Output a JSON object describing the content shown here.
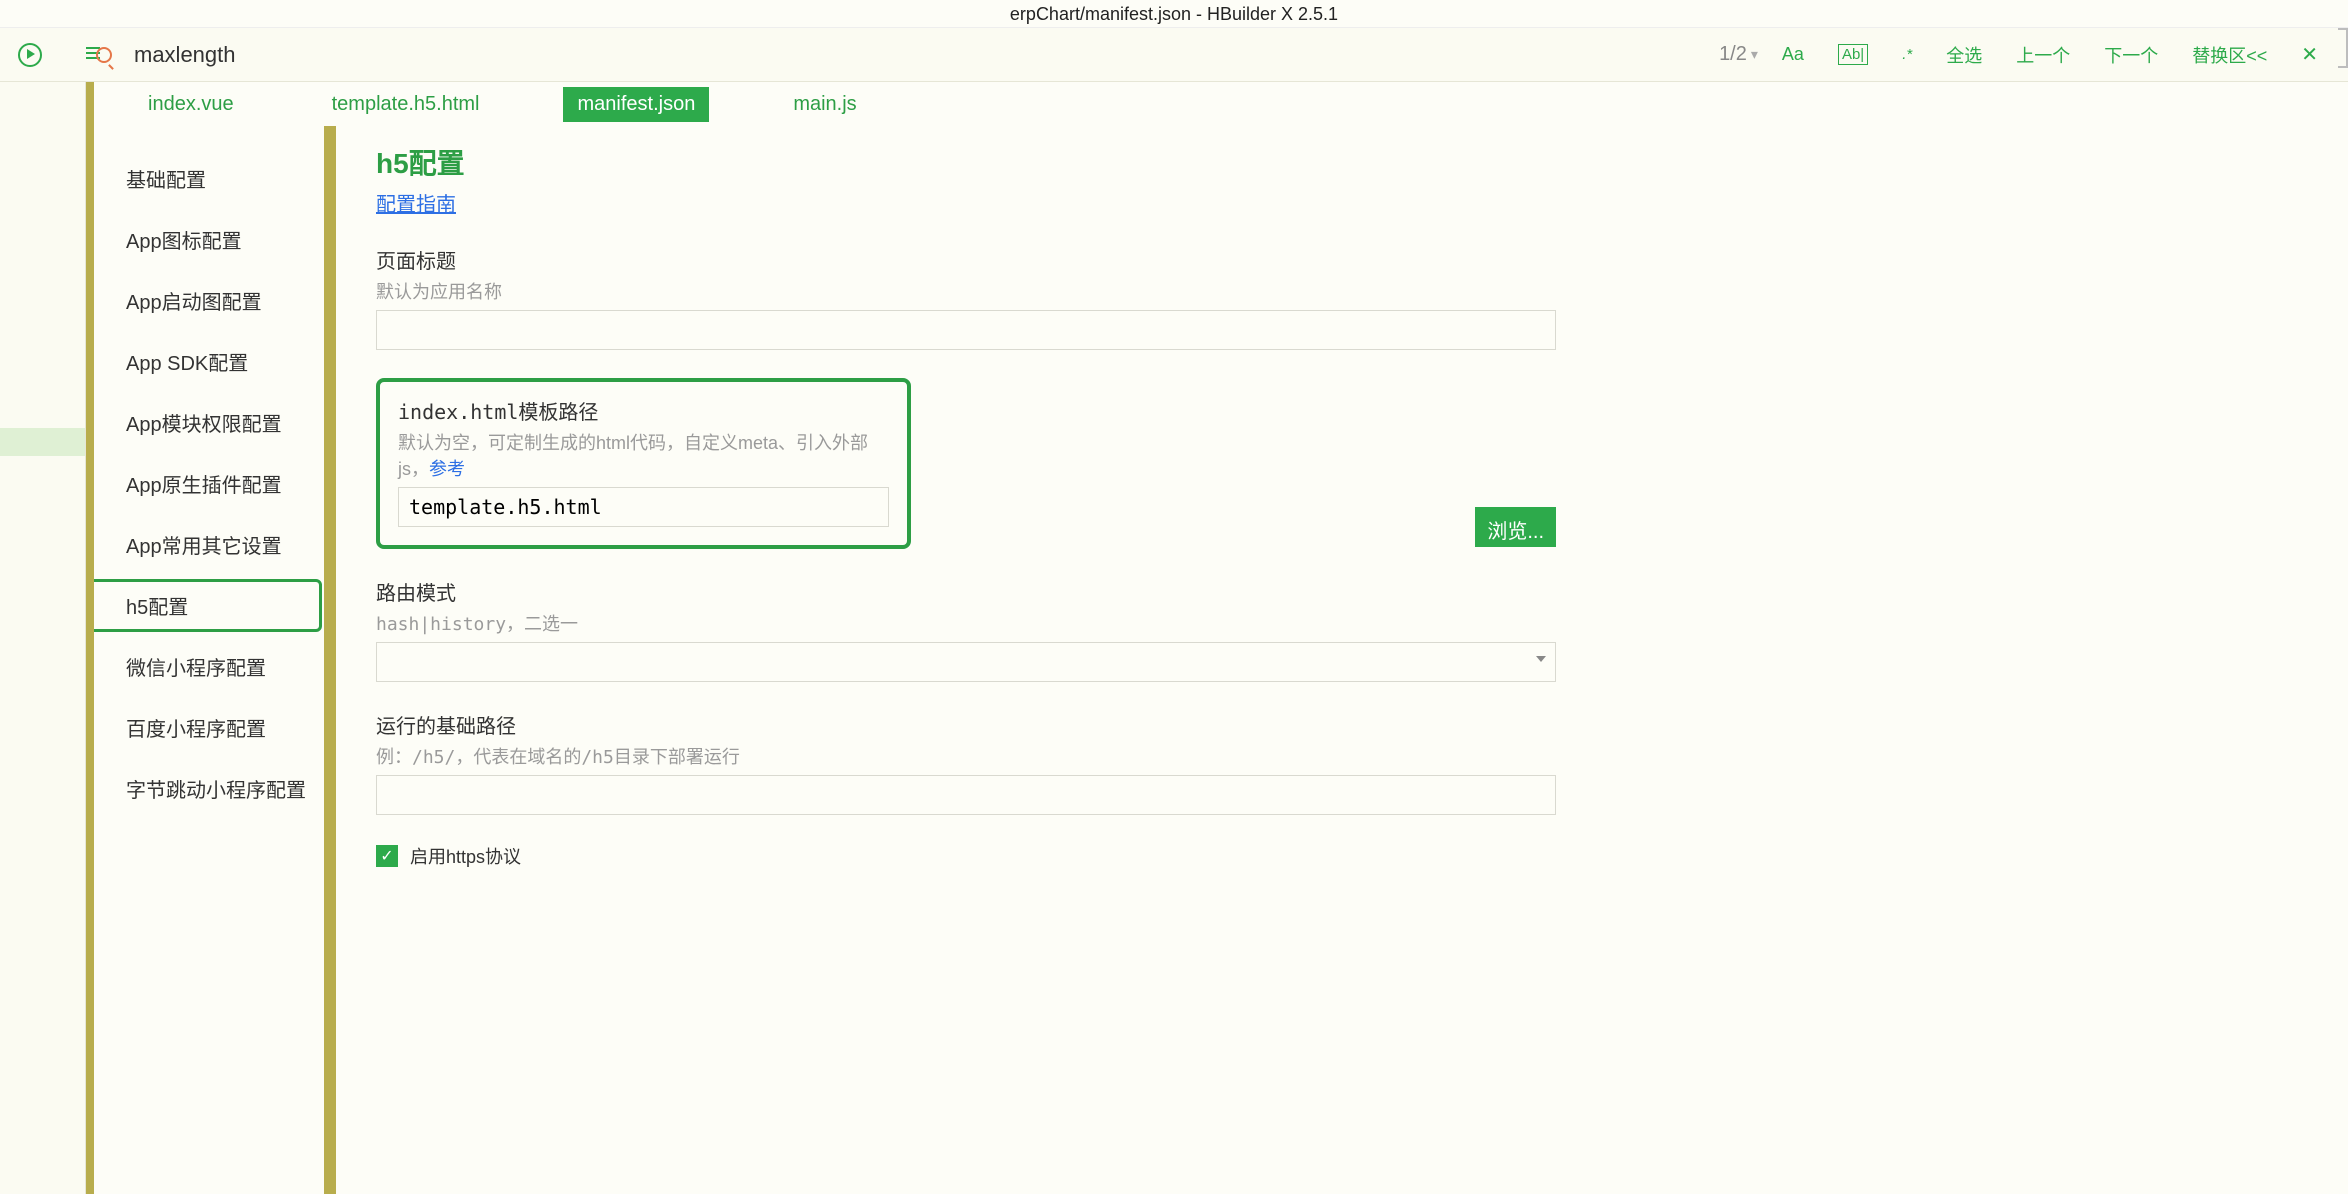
{
  "title": "erpChart/manifest.json - HBuilder X 2.5.1",
  "search": {
    "term": "maxlength",
    "count": "1/2",
    "aa": "Aa",
    "ab": "Ab|",
    "re": ".*",
    "select_all": "全选",
    "prev": "上一个",
    "next": "下一个",
    "replace": "替换区<<",
    "close": "✕"
  },
  "tabs": [
    {
      "label": "index.vue",
      "active": false
    },
    {
      "label": "template.h5.html",
      "active": false
    },
    {
      "label": "manifest.json",
      "active": true
    },
    {
      "label": "main.js",
      "active": false
    }
  ],
  "sidebar": [
    "基础配置",
    "App图标配置",
    "App启动图配置",
    "App  SDK配置",
    "App模块权限配置",
    "App原生插件配置",
    "App常用其它设置",
    "h5配置",
    "微信小程序配置",
    "百度小程序配置",
    "字节跳动小程序配置"
  ],
  "sidebar_selected_index": 7,
  "form": {
    "section_title": "h5配置",
    "guide_link": "配置指南",
    "page_title": {
      "label": "页面标题",
      "sub": "默认为应用名称",
      "value": ""
    },
    "template": {
      "label": "index.html模板路径",
      "sub_prefix": "默认为空，可定制生成的html代码，自定义meta、引入外部js，",
      "sub_link": "参考",
      "value": "template.h5.html",
      "browse": "浏览..."
    },
    "router": {
      "label": "路由模式",
      "sub": "hash|history，二选一",
      "value": ""
    },
    "base_path": {
      "label": "运行的基础路径",
      "sub": "例：/h5/，代表在域名的/h5目录下部署运行",
      "value": ""
    },
    "https": {
      "checked": true,
      "label": "启用https协议"
    }
  }
}
